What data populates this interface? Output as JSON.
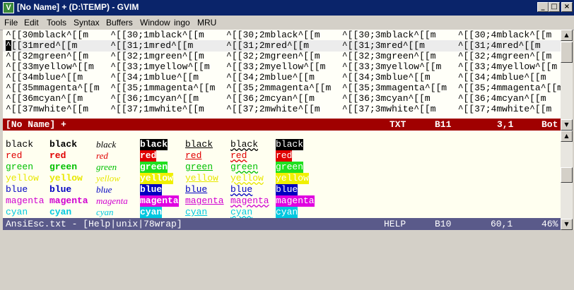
{
  "window": {
    "title": "[No Name] + (D:\\TEMP) - GVIM",
    "app_icon_glyph": "V",
    "minimize_glyph": "_",
    "maximize_glyph": "□",
    "close_glyph": "×"
  },
  "menu": [
    "File",
    "Edit",
    "Tools",
    "Syntax",
    "Buffers",
    "Window",
    "ingo",
    "MRU"
  ],
  "top_buffer": {
    "lines": [
      "^[[30mblack^[[m    ^[[30;1mblack^[[m    ^[[30;2mblack^[[m    ^[[30;3mblack^[[m    ^[[30;4mblack^[[m",
      "^[[31mred^[[m      ^[[31;1mred^[[m      ^[[31;2mred^[[m      ^[[31;3mred^[[m      ^[[31;4mred^[[m",
      "^[[32mgreen^[[m    ^[[32;1mgreen^[[m    ^[[32;2mgreen^[[m    ^[[32;3mgreen^[[m    ^[[32;4mgreen^[[m",
      "^[[33myellow^[[m   ^[[33;1myellow^[[m   ^[[33;2myellow^[[m   ^[[33;3myellow^[[m   ^[[33;4myellow^[[m",
      "^[[34mblue^[[m     ^[[34;1mblue^[[m     ^[[34;2mblue^[[m     ^[[34;3mblue^[[m     ^[[34;4mblue^[[m",
      "^[[35mmagenta^[[m  ^[[35;1mmagenta^[[m  ^[[35;2mmagenta^[[m  ^[[35;3mmagenta^[[m  ^[[35;4mmagenta^[[m",
      "^[[36mcyan^[[m     ^[[36;1mcyan^[[m     ^[[36;2mcyan^[[m     ^[[36;3mcyan^[[m     ^[[36;4mcyan^[[m",
      "^[[37mwhite^[[m    ^[[37;1mwhite^[[m    ^[[37;2mwhite^[[m    ^[[37;3mwhite^[[m    ^[[37;4mwhite^[[m"
    ],
    "cursor_line": 1
  },
  "top_status": {
    "name": "[No Name] +",
    "type": "TXT",
    "buffer": "B11",
    "position": "3,1",
    "scroll": "Bot"
  },
  "bottom_buffer": {
    "colors": [
      {
        "word": "black",
        "fg": "#000000",
        "bg": "#ffffff"
      },
      {
        "word": "red",
        "fg": "#e00000",
        "bg": "#e00000"
      },
      {
        "word": "green",
        "fg": "#00c000",
        "bg": "#20e020"
      },
      {
        "word": "yellow",
        "fg": "#e8e800",
        "bg": "#f0f000"
      },
      {
        "word": "blue",
        "fg": "#0000c0",
        "bg": "#0000c0"
      },
      {
        "word": "magenta",
        "fg": "#d000d0",
        "bg": "#e000e0"
      },
      {
        "word": "cyan",
        "fg": "#00c8e0",
        "bg": "#00c8e0"
      }
    ],
    "styles": [
      "normal",
      "bold",
      "italic",
      "reverse",
      "underline",
      "undercurl",
      "inverse-bold"
    ]
  },
  "bottom_status": {
    "name": "AnsiEsc.txt - [Help|unix|78wrap]",
    "type": "HELP",
    "buffer": "B10",
    "position": "60,1",
    "scroll": "46%"
  },
  "colors": {
    "title_bar": "#0a246a",
    "top_status_bg": "#a00000",
    "bottom_status_bg": "#5a5a8a",
    "buffer_bg": "#fffff8"
  }
}
